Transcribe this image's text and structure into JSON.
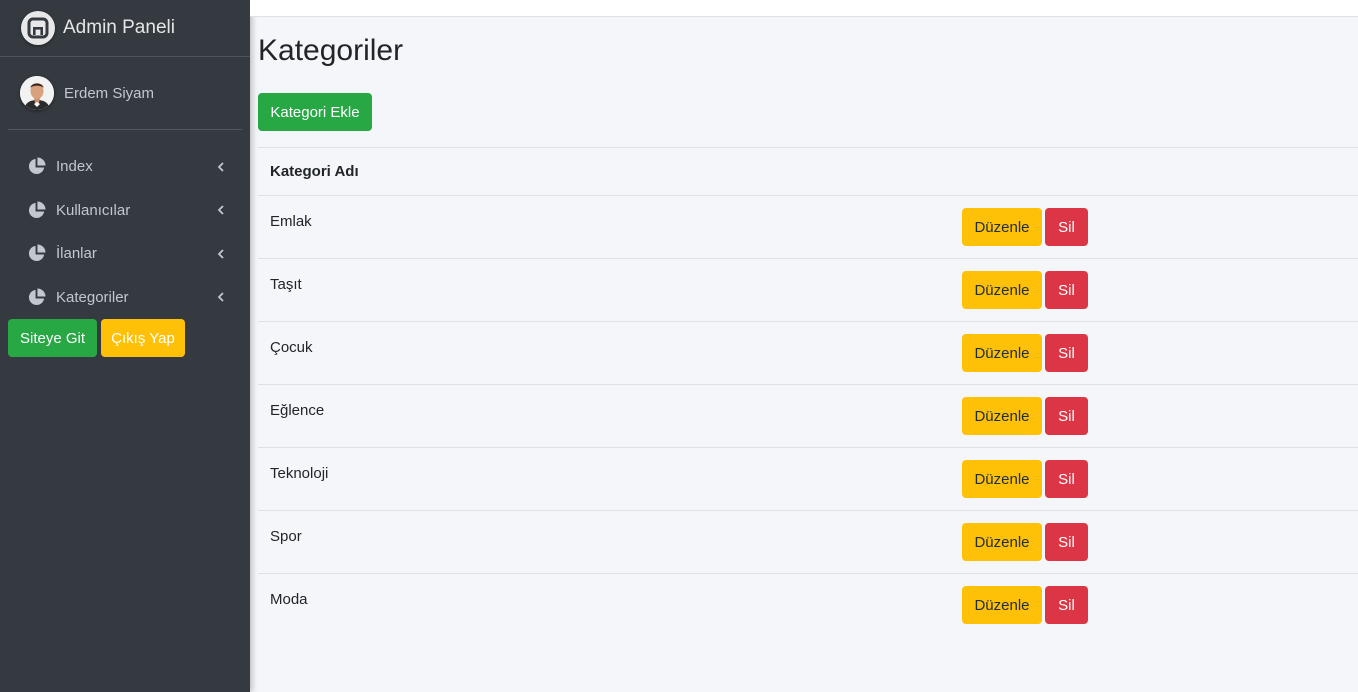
{
  "sidebar": {
    "brand": "Admin Paneli",
    "user_name": "Erdem Siyam",
    "items": [
      {
        "label": "Index"
      },
      {
        "label": "Kullanıcılar"
      },
      {
        "label": "İlanlar"
      },
      {
        "label": "Kategoriler"
      }
    ],
    "site_button": "Siteye Git",
    "logout_button": "Çıkış Yap"
  },
  "main": {
    "title": "Kategoriler",
    "add_button": "Kategori Ekle",
    "table": {
      "header": "Kategori Adı",
      "edit_label": "Düzenle",
      "delete_label": "Sil",
      "rows": [
        "Emlak",
        "Taşıt",
        "Çocuk",
        "Eğlence",
        "Teknoloji",
        "Spor",
        "Moda"
      ]
    }
  },
  "colors": {
    "sidebar_bg": "#343a40",
    "success": "#28a745",
    "warning": "#ffc107",
    "danger": "#dc3545",
    "content_bg": "#f4f6f9"
  }
}
